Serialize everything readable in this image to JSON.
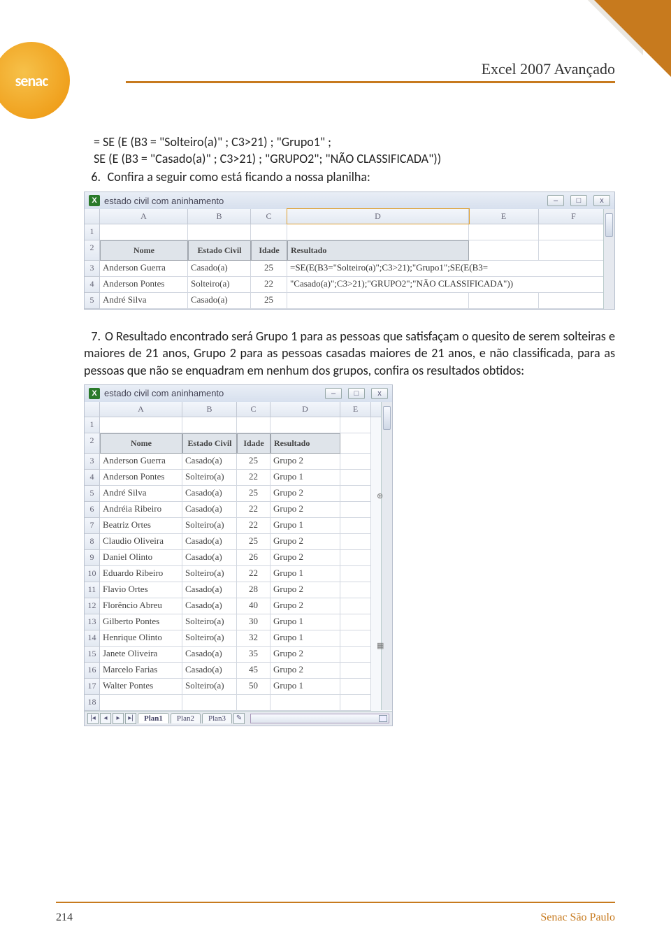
{
  "header": {
    "title": "Excel 2007 Avançado",
    "logo_text": "senac"
  },
  "footer": {
    "page": "214",
    "org": "Senac São Paulo"
  },
  "body": {
    "line1": "= SE (E (B3 = \"Solteiro(a)\" ; C3>21) ; \"Grupo1\" ;",
    "line2": "SE (E (B3 = \"Casado(a)\" ; C3>21) ; \"GRUPO2\"; \"NÃO CLASSIFICADA\"))",
    "item6_num": "6.",
    "item6_text": "Confira a seguir como está ficando a nossa planilha:",
    "item7_num": "7.",
    "item7_text": "O Resultado encontrado será Grupo 1 para as pessoas que satisfaçam o quesito de serem solteiras e maiores de 21 anos, Grupo 2 para as pessoas casadas maiores de 21 anos, e não classificada, para as pessoas que não se enquadram em nenhum dos grupos, confira os resultados obtidos:"
  },
  "shot1": {
    "title": "estado civil com aninhamento",
    "cols": [
      "",
      "A",
      "B",
      "C",
      "D",
      "E",
      "F"
    ],
    "rownums": [
      "1",
      "2",
      "3",
      "4",
      "5"
    ],
    "headers": {
      "nome": "Nome",
      "estado": "Estado Civil",
      "idade": "Idade",
      "resultado": "Resultado"
    },
    "formula1": "=SE(E(B3=\"Solteiro(a)\";C3>21);\"Grupo1\";SE(E(B3=",
    "formula2": "\"Casado(a)\";C3>21);\"GRUPO2\";\"NÃO CLASSIFICADA\"))",
    "rows": [
      {
        "nome": "Anderson Guerra",
        "ec": "Casado(a)",
        "idade": "25"
      },
      {
        "nome": "Anderson Pontes",
        "ec": "Solteiro(a)",
        "idade": "22"
      },
      {
        "nome": "André Silva",
        "ec": "Casado(a)",
        "idade": "25"
      }
    ]
  },
  "shot2": {
    "title": "estado civil com aninhamento",
    "cols": [
      "",
      "A",
      "B",
      "C",
      "D",
      "E"
    ],
    "headers": {
      "nome": "Nome",
      "estado": "Estado Civil",
      "idade": "Idade",
      "resultado": "Resultado"
    },
    "rows": [
      {
        "n": "3",
        "nome": "Anderson Guerra",
        "ec": "Casado(a)",
        "id": "25",
        "res": "Grupo 2"
      },
      {
        "n": "4",
        "nome": "Anderson Pontes",
        "ec": "Solteiro(a)",
        "id": "22",
        "res": "Grupo 1"
      },
      {
        "n": "5",
        "nome": "André Silva",
        "ec": "Casado(a)",
        "id": "25",
        "res": "Grupo 2"
      },
      {
        "n": "6",
        "nome": "Andréia Ribeiro",
        "ec": "Casado(a)",
        "id": "22",
        "res": "Grupo 2"
      },
      {
        "n": "7",
        "nome": "Beatriz Ortes",
        "ec": "Solteiro(a)",
        "id": "22",
        "res": "Grupo 1"
      },
      {
        "n": "8",
        "nome": "Claudio Oliveira",
        "ec": "Casado(a)",
        "id": "25",
        "res": "Grupo 2"
      },
      {
        "n": "9",
        "nome": "Daniel Olinto",
        "ec": "Casado(a)",
        "id": "26",
        "res": "Grupo 2"
      },
      {
        "n": "10",
        "nome": "Eduardo Ribeiro",
        "ec": "Solteiro(a)",
        "id": "22",
        "res": "Grupo 1"
      },
      {
        "n": "11",
        "nome": "Flavio Ortes",
        "ec": "Casado(a)",
        "id": "28",
        "res": "Grupo 2"
      },
      {
        "n": "12",
        "nome": "Florêncio Abreu",
        "ec": "Casado(a)",
        "id": "40",
        "res": "Grupo 2"
      },
      {
        "n": "13",
        "nome": "Gilberto Pontes",
        "ec": "Solteiro(a)",
        "id": "30",
        "res": "Grupo 1"
      },
      {
        "n": "14",
        "nome": "Henrique Olinto",
        "ec": "Solteiro(a)",
        "id": "32",
        "res": "Grupo 1"
      },
      {
        "n": "15",
        "nome": "Janete Oliveira",
        "ec": "Casado(a)",
        "id": "35",
        "res": "Grupo 2"
      },
      {
        "n": "16",
        "nome": "Marcelo Farias",
        "ec": "Casado(a)",
        "id": "45",
        "res": "Grupo 2"
      },
      {
        "n": "17",
        "nome": "Walter Pontes",
        "ec": "Solteiro(a)",
        "id": "50",
        "res": "Grupo 1"
      }
    ],
    "emptyrow": "18",
    "tabs": {
      "p1": "Plan1",
      "p2": "Plan2",
      "p3": "Plan3"
    },
    "fillmarker": "⊕",
    "tablemarker": "▦"
  },
  "winbtns": {
    "min": "–",
    "max": "□",
    "close": "x"
  },
  "nav": {
    "first": "|◂",
    "prev": "◂",
    "next": "▸",
    "last": "▸|",
    "new": "✎"
  }
}
